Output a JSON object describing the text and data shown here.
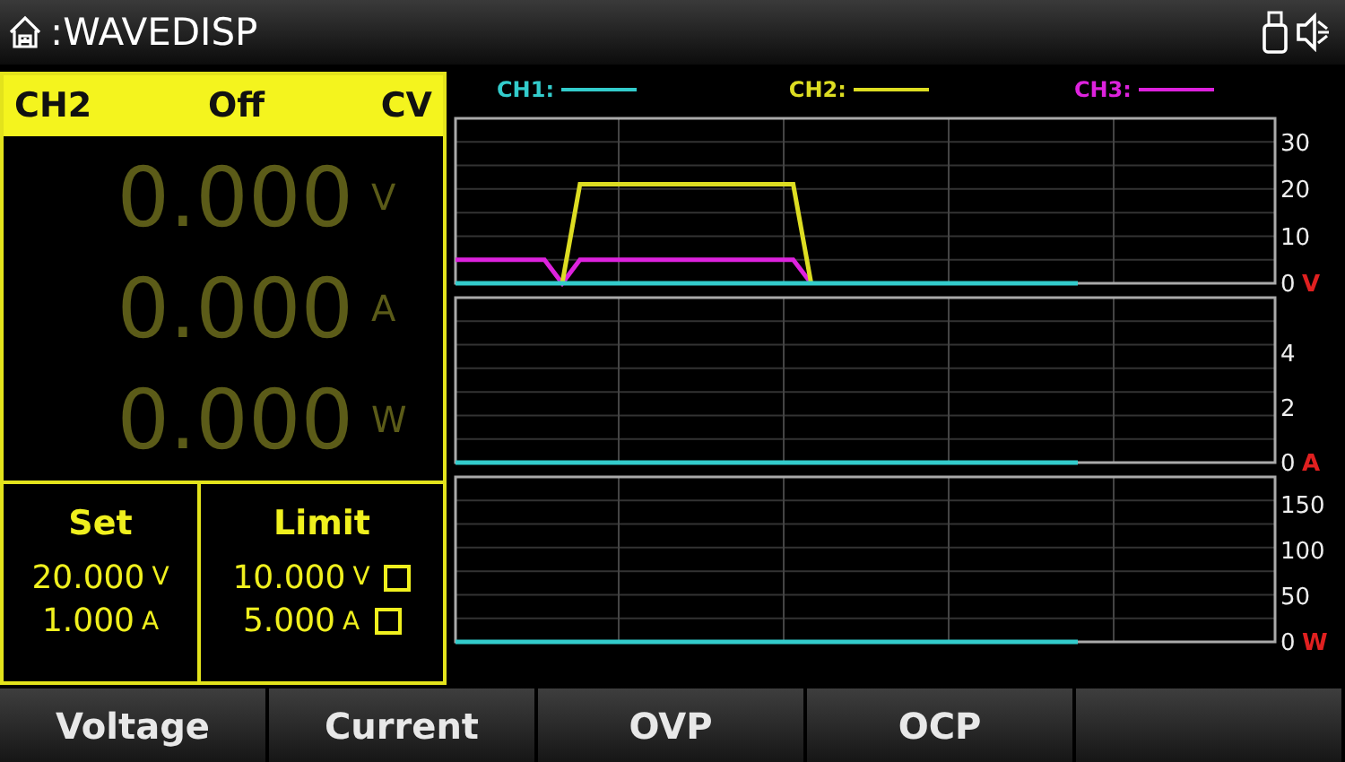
{
  "title_bar": {
    "title": ":WAVEDISP"
  },
  "channel_panel": {
    "channel": "CH2",
    "output": "Off",
    "mode": "CV",
    "readings": [
      {
        "value": "0.000",
        "unit": "V"
      },
      {
        "value": "0.000",
        "unit": "A"
      },
      {
        "value": "0.000",
        "unit": "W"
      }
    ],
    "set": {
      "heading": "Set",
      "values": [
        {
          "value": "20.000",
          "unit": "V"
        },
        {
          "value": "1.000",
          "unit": "A"
        }
      ]
    },
    "limit": {
      "heading": "Limit",
      "values": [
        {
          "value": "10.000",
          "unit": "V",
          "checked": false
        },
        {
          "value": "5.000",
          "unit": "A",
          "checked": false
        }
      ]
    }
  },
  "legend": [
    {
      "label": "CH1:",
      "color": "#33cccc"
    },
    {
      "label": "CH2:",
      "color": "#dddd22"
    },
    {
      "label": "CH3:",
      "color": "#dd22dd"
    }
  ],
  "charts": [
    {
      "unit": "V",
      "chart_data": {
        "type": "line",
        "grid": true,
        "ylim": [
          0,
          35
        ],
        "yticks": [
          0,
          10,
          20,
          30
        ],
        "series": [
          {
            "color": "#dd22dd",
            "values": [
              5,
              5,
              5,
              5,
              5,
              5,
              0,
              5,
              5,
              5,
              5,
              5,
              5,
              5,
              5,
              5,
              5,
              5,
              5,
              5,
              0,
              null,
              null,
              null,
              null,
              null,
              null,
              null,
              null,
              null,
              null,
              null,
              null,
              null,
              null,
              null,
              null,
              null,
              null,
              null,
              null,
              null,
              null,
              null,
              null,
              null,
              null
            ]
          },
          {
            "color": "#dddd22",
            "values": [
              null,
              null,
              null,
              null,
              null,
              null,
              0,
              21,
              21,
              21,
              21,
              21,
              21,
              21,
              21,
              21,
              21,
              21,
              21,
              21,
              0,
              null,
              null,
              null,
              null,
              null,
              null,
              null,
              null,
              null,
              null,
              null,
              null,
              null,
              null,
              null,
              null,
              null,
              null,
              null,
              null,
              null,
              null,
              null,
              null,
              null,
              null
            ]
          },
          {
            "color": "#33cccc",
            "values": [
              0,
              0,
              0,
              0,
              0,
              0,
              0,
              0,
              0,
              0,
              0,
              0,
              0,
              0,
              0,
              0,
              0,
              0,
              0,
              0,
              0,
              0,
              0,
              0,
              0,
              0,
              0,
              0,
              0,
              0,
              0,
              0,
              0,
              0,
              0,
              0,
              null,
              null,
              null,
              null,
              null,
              null,
              null,
              null,
              null,
              null,
              null
            ]
          }
        ]
      }
    },
    {
      "unit": "A",
      "chart_data": {
        "type": "line",
        "grid": true,
        "ylim": [
          0,
          6
        ],
        "yticks": [
          0,
          2,
          4
        ],
        "series": [
          {
            "color": "#33cccc",
            "values": [
              0,
              0,
              0,
              0,
              0,
              0,
              0,
              0,
              0,
              0,
              0,
              0,
              0,
              0,
              0,
              0,
              0,
              0,
              0,
              0,
              0,
              0,
              0,
              0,
              0,
              0,
              0,
              0,
              0,
              0,
              0,
              0,
              0,
              0,
              0,
              0,
              null,
              null,
              null,
              null,
              null,
              null,
              null,
              null,
              null,
              null,
              null
            ]
          }
        ]
      }
    },
    {
      "unit": "W",
      "chart_data": {
        "type": "line",
        "grid": true,
        "ylim": [
          0,
          180
        ],
        "yticks": [
          0,
          50,
          100,
          150
        ],
        "series": [
          {
            "color": "#33cccc",
            "values": [
              0,
              0,
              0,
              0,
              0,
              0,
              0,
              0,
              0,
              0,
              0,
              0,
              0,
              0,
              0,
              0,
              0,
              0,
              0,
              0,
              0,
              0,
              0,
              0,
              0,
              0,
              0,
              0,
              0,
              0,
              0,
              0,
              0,
              0,
              0,
              0,
              null,
              null,
              null,
              null,
              null,
              null,
              null,
              null,
              null,
              null,
              null
            ]
          }
        ]
      }
    }
  ],
  "softkeys": [
    {
      "label": "Voltage"
    },
    {
      "label": "Current"
    },
    {
      "label": "OVP"
    },
    {
      "label": "OCP"
    }
  ]
}
